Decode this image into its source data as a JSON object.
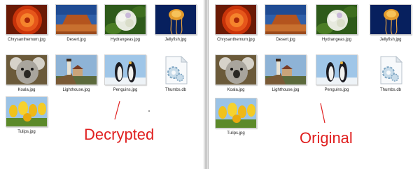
{
  "panes": [
    {
      "caption": "Decrypted",
      "files": [
        {
          "name": "Chrysanthemum.jpg",
          "thumb": "chrysanthemum"
        },
        {
          "name": "Desert.jpg",
          "thumb": "desert"
        },
        {
          "name": "Hydrangeas.jpg",
          "thumb": "hydrangeas"
        },
        {
          "name": "Jellyfish.jpg",
          "thumb": "jellyfish"
        },
        {
          "name": "Koala.jpg",
          "thumb": "koala"
        },
        {
          "name": "Lighthouse.jpg",
          "thumb": "lighthouse"
        },
        {
          "name": "Penguins.jpg",
          "thumb": "penguins"
        },
        {
          "name": "Thumbs.db",
          "thumb": "settings-file-icon"
        },
        {
          "name": "Tulips.jpg",
          "thumb": "tulips"
        }
      ]
    },
    {
      "caption": "Original",
      "files": [
        {
          "name": "Chrysanthemum.jpg",
          "thumb": "chrysanthemum"
        },
        {
          "name": "Desert.jpg",
          "thumb": "desert"
        },
        {
          "name": "Hydrangeas.jpg",
          "thumb": "hydrangeas"
        },
        {
          "name": "Jellyfish.jpg",
          "thumb": "jellyfish"
        },
        {
          "name": "Koala.jpg",
          "thumb": "koala"
        },
        {
          "name": "Lighthouse.jpg",
          "thumb": "lighthouse"
        },
        {
          "name": "Penguins.jpg",
          "thumb": "penguins"
        },
        {
          "name": "Thumbs.db",
          "thumb": "settings-file-icon"
        },
        {
          "name": "Tulips.jpg",
          "thumb": "tulips"
        }
      ]
    }
  ],
  "colors": {
    "caption": "#e02020",
    "background": "#ffffff"
  }
}
